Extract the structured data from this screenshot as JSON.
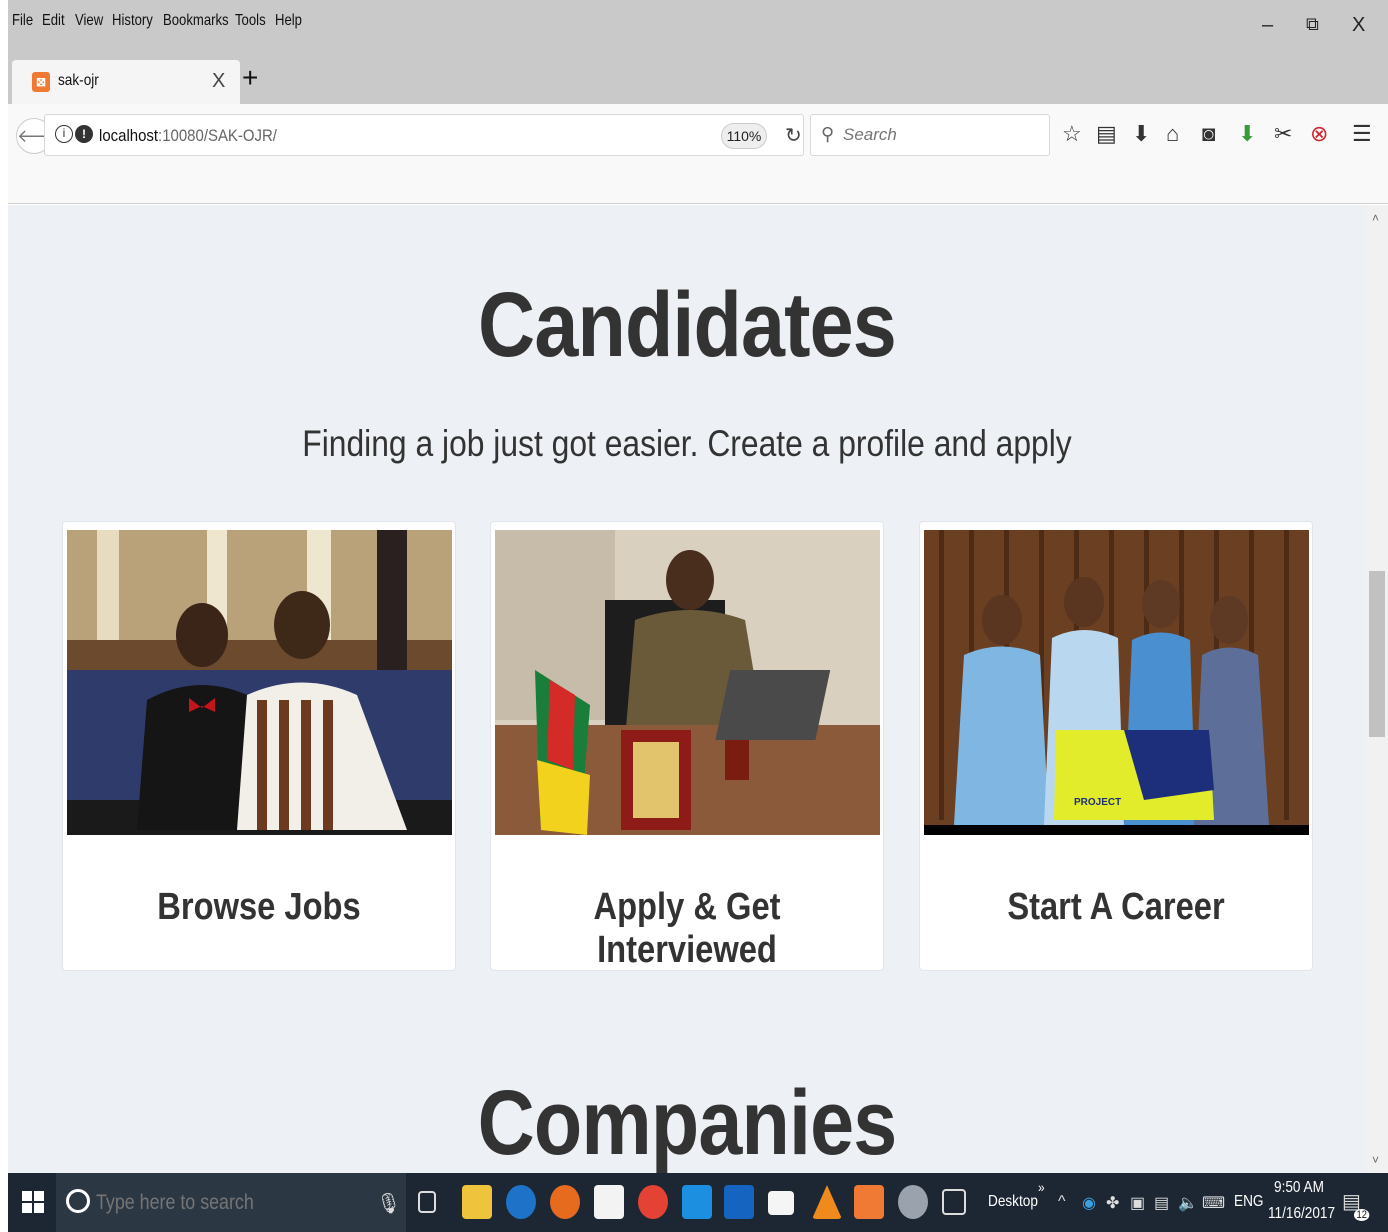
{
  "menubar": {
    "items": [
      "File",
      "Edit",
      "View",
      "History",
      "Bookmarks",
      "Tools",
      "Help"
    ],
    "underline": [
      "F",
      "E",
      "V",
      "s",
      "B",
      "T",
      "H"
    ]
  },
  "tab": {
    "title": "sak-ojr",
    "favicon": "xampp-icon",
    "close": "X",
    "new_tab": "+"
  },
  "window_controls": {
    "minimize": "–",
    "restore": "⧉",
    "close": "X"
  },
  "navbar": {
    "url_host": "localhost",
    "url_path": ":10080/SAK-OJR/",
    "zoom": "110%",
    "search_placeholder": "Search"
  },
  "page": {
    "candidates_title": "Candidates",
    "candidates_subtitle": "Finding a job just got easier. Create a profile and apply",
    "cards": [
      {
        "label": "Browse Jobs",
        "image": "two-students-photo"
      },
      {
        "label": "Apply & Get Interviewed",
        "image": "office-desk-photo"
      },
      {
        "label": "Start A Career",
        "image": "award-team-photo"
      }
    ],
    "companies_title": "Companies"
  },
  "taskbar": {
    "search_placeholder": "Type here to search",
    "desktop_label": "Desktop",
    "overflow": "»",
    "lang": "ENG",
    "time": "9:50 AM",
    "date": "11/16/2017",
    "notification_count": "12"
  },
  "colors": {
    "page_bg": "#edf0f5",
    "taskbar_bg": "#1d2733",
    "heading": "#333333",
    "chrome_bg": "#c9c9c9"
  }
}
